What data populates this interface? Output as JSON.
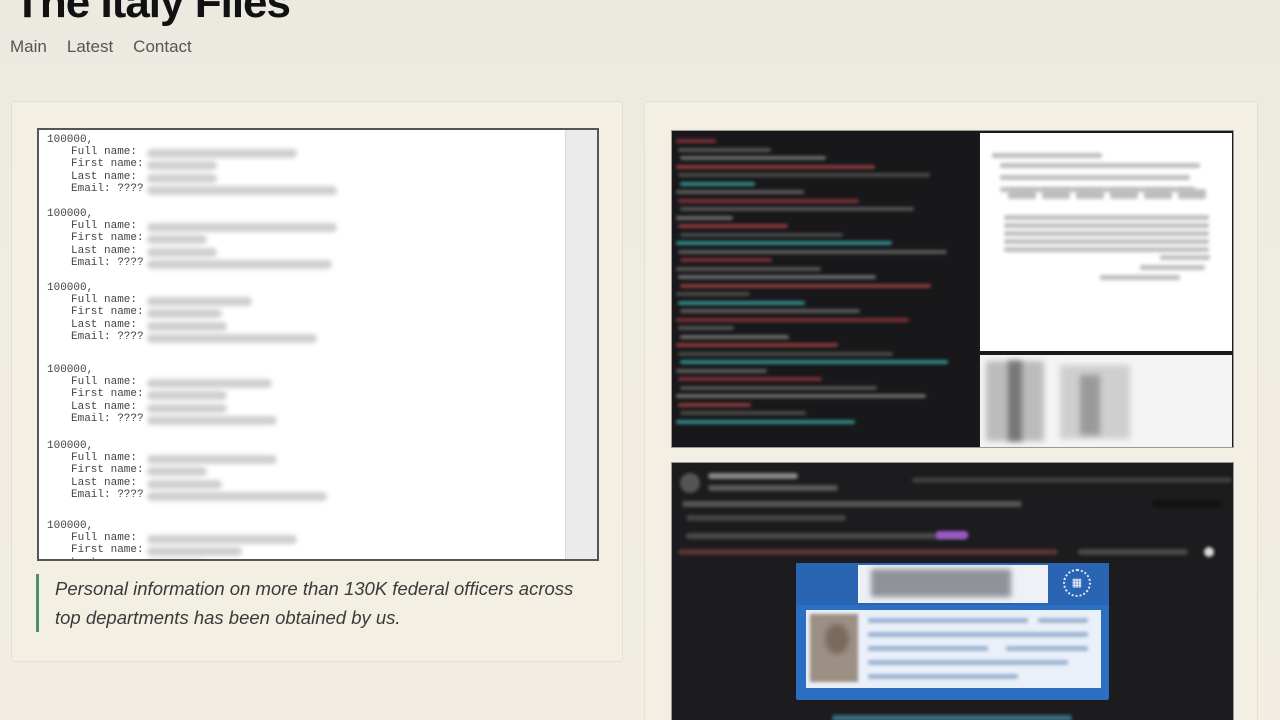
{
  "site": {
    "title": "The Italy Files",
    "nav": [
      "Main",
      "Latest",
      "Contact"
    ]
  },
  "post_left": {
    "doc_record_id": "100000,",
    "doc_fields": [
      "Full name:",
      "First name:",
      "Last name:",
      "Email: ????"
    ],
    "caption": "Personal information on more than 130K federal officers across top departments has been obtained by us."
  },
  "colors": {
    "background": "#ede9e0",
    "card": "#f3efe3",
    "caption_accent": "#4e8f66",
    "id_card_blue": "#2c6fc2"
  }
}
